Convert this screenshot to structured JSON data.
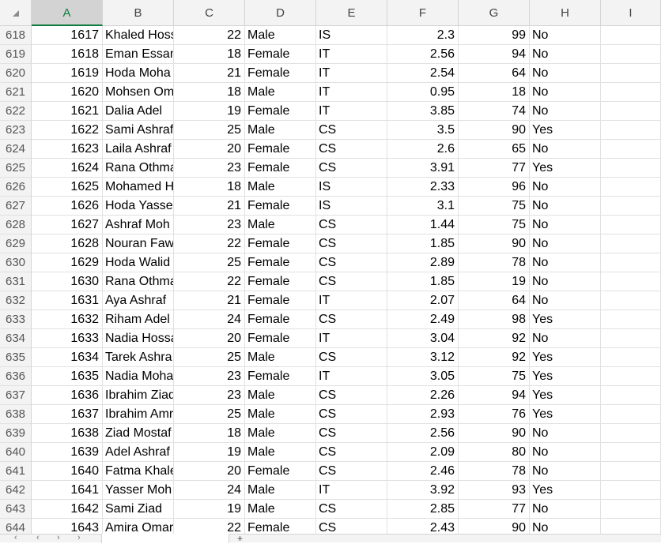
{
  "columns": [
    "A",
    "B",
    "C",
    "D",
    "E",
    "F",
    "G",
    "H",
    "I"
  ],
  "selected_column": "A",
  "rows": [
    {
      "n": "618",
      "id": "1617",
      "name": "Khaled Hoss",
      "age": "22",
      "gender": "Male",
      "dept": "IS",
      "gpa": "2.3",
      "score": "99",
      "flag": "No"
    },
    {
      "n": "619",
      "id": "1618",
      "name": "Eman Essam",
      "age": "18",
      "gender": "Female",
      "dept": "IT",
      "gpa": "2.56",
      "score": "94",
      "flag": "No"
    },
    {
      "n": "620",
      "id": "1619",
      "name": "Hoda Moha",
      "age": "21",
      "gender": "Female",
      "dept": "IT",
      "gpa": "2.54",
      "score": "64",
      "flag": "No"
    },
    {
      "n": "621",
      "id": "1620",
      "name": "Mohsen Om",
      "age": "18",
      "gender": "Male",
      "dept": "IT",
      "gpa": "0.95",
      "score": "18",
      "flag": "No"
    },
    {
      "n": "622",
      "id": "1621",
      "name": "Dalia Adel",
      "age": "19",
      "gender": "Female",
      "dept": "IT",
      "gpa": "3.85",
      "score": "74",
      "flag": "No"
    },
    {
      "n": "623",
      "id": "1622",
      "name": "Sami Ashraf",
      "age": "25",
      "gender": "Male",
      "dept": "CS",
      "gpa": "3.5",
      "score": "90",
      "flag": "Yes"
    },
    {
      "n": "624",
      "id": "1623",
      "name": "Laila Ashraf",
      "age": "20",
      "gender": "Female",
      "dept": "CS",
      "gpa": "2.6",
      "score": "65",
      "flag": "No"
    },
    {
      "n": "625",
      "id": "1624",
      "name": "Rana Othma",
      "age": "23",
      "gender": "Female",
      "dept": "CS",
      "gpa": "3.91",
      "score": "77",
      "flag": "Yes"
    },
    {
      "n": "626",
      "id": "1625",
      "name": "Mohamed H",
      "age": "18",
      "gender": "Male",
      "dept": "IS",
      "gpa": "2.33",
      "score": "96",
      "flag": "No"
    },
    {
      "n": "627",
      "id": "1626",
      "name": "Hoda Yasser",
      "age": "21",
      "gender": "Female",
      "dept": "IS",
      "gpa": "3.1",
      "score": "75",
      "flag": "No"
    },
    {
      "n": "628",
      "id": "1627",
      "name": "Ashraf Moh",
      "age": "23",
      "gender": "Male",
      "dept": "CS",
      "gpa": "1.44",
      "score": "75",
      "flag": "No"
    },
    {
      "n": "629",
      "id": "1628",
      "name": "Nouran Faw",
      "age": "22",
      "gender": "Female",
      "dept": "CS",
      "gpa": "1.85",
      "score": "90",
      "flag": "No"
    },
    {
      "n": "630",
      "id": "1629",
      "name": "Hoda Walid",
      "age": "25",
      "gender": "Female",
      "dept": "CS",
      "gpa": "2.89",
      "score": "78",
      "flag": "No"
    },
    {
      "n": "631",
      "id": "1630",
      "name": "Rana Othma",
      "age": "22",
      "gender": "Female",
      "dept": "CS",
      "gpa": "1.85",
      "score": "19",
      "flag": "No"
    },
    {
      "n": "632",
      "id": "1631",
      "name": "Aya Ashraf",
      "age": "21",
      "gender": "Female",
      "dept": "IT",
      "gpa": "2.07",
      "score": "64",
      "flag": "No"
    },
    {
      "n": "633",
      "id": "1632",
      "name": "Riham Adel",
      "age": "24",
      "gender": "Female",
      "dept": "CS",
      "gpa": "2.49",
      "score": "98",
      "flag": "Yes"
    },
    {
      "n": "634",
      "id": "1633",
      "name": "Nadia Hossa",
      "age": "20",
      "gender": "Female",
      "dept": "IT",
      "gpa": "3.04",
      "score": "92",
      "flag": "No"
    },
    {
      "n": "635",
      "id": "1634",
      "name": "Tarek Ashra",
      "age": "25",
      "gender": "Male",
      "dept": "CS",
      "gpa": "3.12",
      "score": "92",
      "flag": "Yes"
    },
    {
      "n": "636",
      "id": "1635",
      "name": "Nadia Moha",
      "age": "23",
      "gender": "Female",
      "dept": "IT",
      "gpa": "3.05",
      "score": "75",
      "flag": "Yes"
    },
    {
      "n": "637",
      "id": "1636",
      "name": "Ibrahim Ziad",
      "age": "23",
      "gender": "Male",
      "dept": "CS",
      "gpa": "2.26",
      "score": "94",
      "flag": "Yes"
    },
    {
      "n": "638",
      "id": "1637",
      "name": "Ibrahim Amr",
      "age": "25",
      "gender": "Male",
      "dept": "CS",
      "gpa": "2.93",
      "score": "76",
      "flag": "Yes"
    },
    {
      "n": "639",
      "id": "1638",
      "name": "Ziad Mostaf",
      "age": "18",
      "gender": "Male",
      "dept": "CS",
      "gpa": "2.56",
      "score": "90",
      "flag": "No"
    },
    {
      "n": "640",
      "id": "1639",
      "name": "Adel Ashraf",
      "age": "19",
      "gender": "Male",
      "dept": "CS",
      "gpa": "2.09",
      "score": "80",
      "flag": "No"
    },
    {
      "n": "641",
      "id": "1640",
      "name": "Fatma Khale",
      "age": "20",
      "gender": "Female",
      "dept": "CS",
      "gpa": "2.46",
      "score": "78",
      "flag": "No"
    },
    {
      "n": "642",
      "id": "1641",
      "name": "Yasser Moh",
      "age": "24",
      "gender": "Male",
      "dept": "IT",
      "gpa": "3.92",
      "score": "93",
      "flag": "Yes"
    },
    {
      "n": "643",
      "id": "1642",
      "name": "Sami Ziad",
      "age": "19",
      "gender": "Male",
      "dept": "CS",
      "gpa": "2.85",
      "score": "77",
      "flag": "No"
    },
    {
      "n": "644",
      "id": "1643",
      "name": "Amira Omar",
      "age": "22",
      "gender": "Female",
      "dept": "CS",
      "gpa": "2.43",
      "score": "90",
      "flag": "No"
    }
  ],
  "colors": {
    "accent": "#107c41",
    "header_bg": "#f3f3f3",
    "gridline": "#e1e1e1"
  },
  "icons": {
    "select_all": "select-all-triangle-icon",
    "nav": "chevron-icon",
    "add": "plus-icon"
  }
}
